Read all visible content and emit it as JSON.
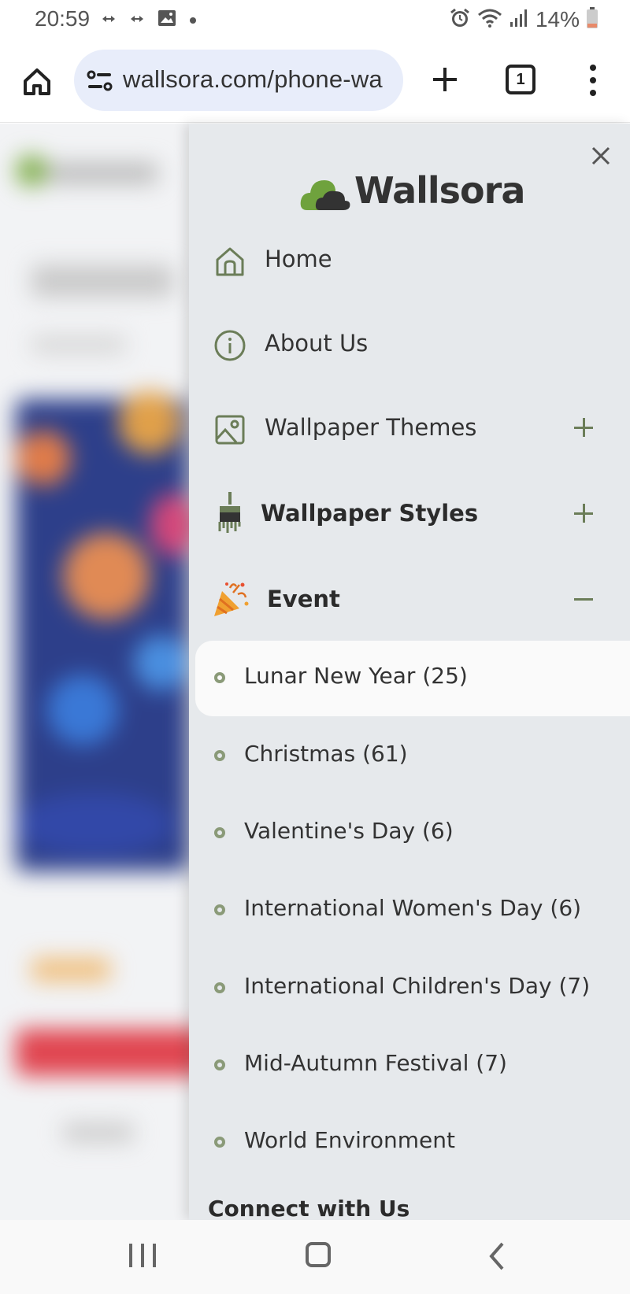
{
  "status_bar": {
    "time": "20:59",
    "battery": "14%"
  },
  "browser": {
    "url": "wallsora.com/phone-wa",
    "tab_count": "1"
  },
  "drawer": {
    "logo_text": "Wallsora",
    "nav_items": [
      {
        "label": "Home",
        "icon": "home-icon"
      },
      {
        "label": "About Us",
        "icon": "info-icon"
      },
      {
        "label": "Wallpaper Themes",
        "icon": "image-icon",
        "toggle": "+"
      },
      {
        "label": "Wallpaper Styles",
        "icon": "paint-brush-icon",
        "toggle": "+"
      },
      {
        "label": "Event",
        "icon": "party-popper-icon",
        "toggle": "−"
      }
    ],
    "event_items": [
      {
        "label": "Lunar New Year (25)",
        "active": true
      },
      {
        "label": "Christmas (61)"
      },
      {
        "label": "Valentine's Day (6)"
      },
      {
        "label": "International Women's Day (6)"
      },
      {
        "label": "International Children's Day (7)"
      },
      {
        "label": "Mid-Autumn Festival (7)"
      },
      {
        "label": "World Environment"
      }
    ],
    "connect_title": "Connect with Us"
  },
  "colors": {
    "accent_green": "#6b7d58",
    "drawer_bg": "#e6e9ec",
    "url_bg": "#e8edfa"
  }
}
